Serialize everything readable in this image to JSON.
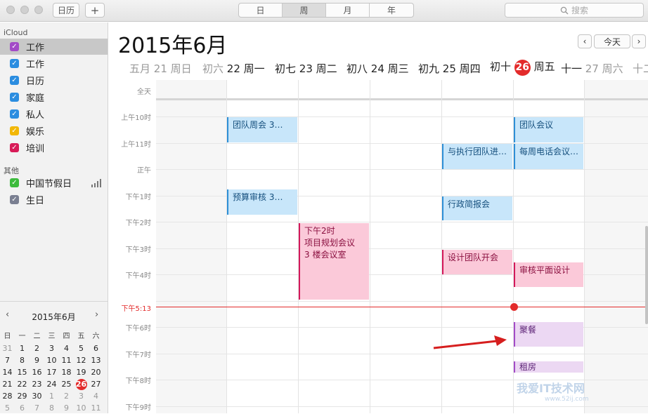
{
  "toolbar": {
    "calendars_label": "日历",
    "add_label": "+",
    "views": [
      "日",
      "周",
      "月",
      "年"
    ],
    "active_view": "周",
    "search_placeholder": "搜索"
  },
  "sidebar": {
    "group_icloud": "iCloud",
    "icloud_items": [
      {
        "label": "工作",
        "color": "#a34bc7",
        "selected": true
      },
      {
        "label": "工作",
        "color": "#2b8de0"
      },
      {
        "label": "日历",
        "color": "#2b8de0"
      },
      {
        "label": "家庭",
        "color": "#2b8de0"
      },
      {
        "label": "私人",
        "color": "#2b8de0"
      },
      {
        "label": "娱乐",
        "color": "#f2b705"
      },
      {
        "label": "培训",
        "color": "#d81b57"
      }
    ],
    "group_other": "其他",
    "other_items": [
      {
        "label": "中国节假日",
        "color": "#3dbb3d"
      },
      {
        "label": "生日",
        "color": "#7a7f91"
      }
    ]
  },
  "mini_calendar": {
    "title": "2015年6月",
    "weekdays": [
      "日",
      "一",
      "二",
      "三",
      "四",
      "五",
      "六"
    ],
    "weeks": [
      [
        "31",
        "1",
        "2",
        "3",
        "4",
        "5",
        "6"
      ],
      [
        "7",
        "8",
        "9",
        "10",
        "11",
        "12",
        "13"
      ],
      [
        "14",
        "15",
        "16",
        "17",
        "18",
        "19",
        "20"
      ],
      [
        "21",
        "22",
        "23",
        "24",
        "25",
        "26",
        "27"
      ],
      [
        "28",
        "29",
        "30",
        "1",
        "2",
        "3",
        "4"
      ],
      [
        "5",
        "6",
        "7",
        "8",
        "9",
        "10",
        "11"
      ]
    ]
  },
  "header": {
    "title": "2015年6月",
    "today_label": "今天",
    "days": [
      {
        "lunar": "五月",
        "date": "21",
        "weekday": "周日"
      },
      {
        "lunar": "初六",
        "date": "22",
        "weekday": "周一"
      },
      {
        "lunar": "初七",
        "date": "23",
        "weekday": "周二"
      },
      {
        "lunar": "初八",
        "date": "24",
        "weekday": "周三"
      },
      {
        "lunar": "初九",
        "date": "25",
        "weekday": "周四"
      },
      {
        "lunar": "初十",
        "date": "26",
        "weekday": "周五"
      },
      {
        "lunar": "十一",
        "date": "27",
        "weekday": "周六"
      },
      {
        "lunar": "十二",
        "date": "",
        "weekday": ""
      }
    ]
  },
  "grid": {
    "allday_label": "全天",
    "hours": [
      "上午10时",
      "上午11时",
      "正午",
      "下午1时",
      "下午2时",
      "下午3时",
      "下午4时",
      "下午6时",
      "下午7时",
      "下午8时",
      "下午9时"
    ],
    "now_label": "下午5:13"
  },
  "events": [
    {
      "title": "团队周会 3…",
      "color": "blue"
    },
    {
      "title": "预算审核 3…",
      "color": "blue"
    },
    {
      "title": "下午2时",
      "line2": "项目规划会议",
      "line3": "3 楼会议室",
      "color": "pink"
    },
    {
      "title": "与执行团队进…",
      "color": "blue"
    },
    {
      "title": "行政简报会",
      "color": "blue"
    },
    {
      "title": "设计团队开会",
      "color": "pink"
    },
    {
      "title": "团队会议",
      "color": "blue"
    },
    {
      "title": "每周电话会议…",
      "color": "blue"
    },
    {
      "title": "审核平面设计",
      "color": "pink"
    },
    {
      "title": "聚餐",
      "color": "purple"
    },
    {
      "title": "租房",
      "color": "purple"
    }
  ],
  "watermark": {
    "text": "我爱IT技术网",
    "url": "www.52ij.com"
  }
}
